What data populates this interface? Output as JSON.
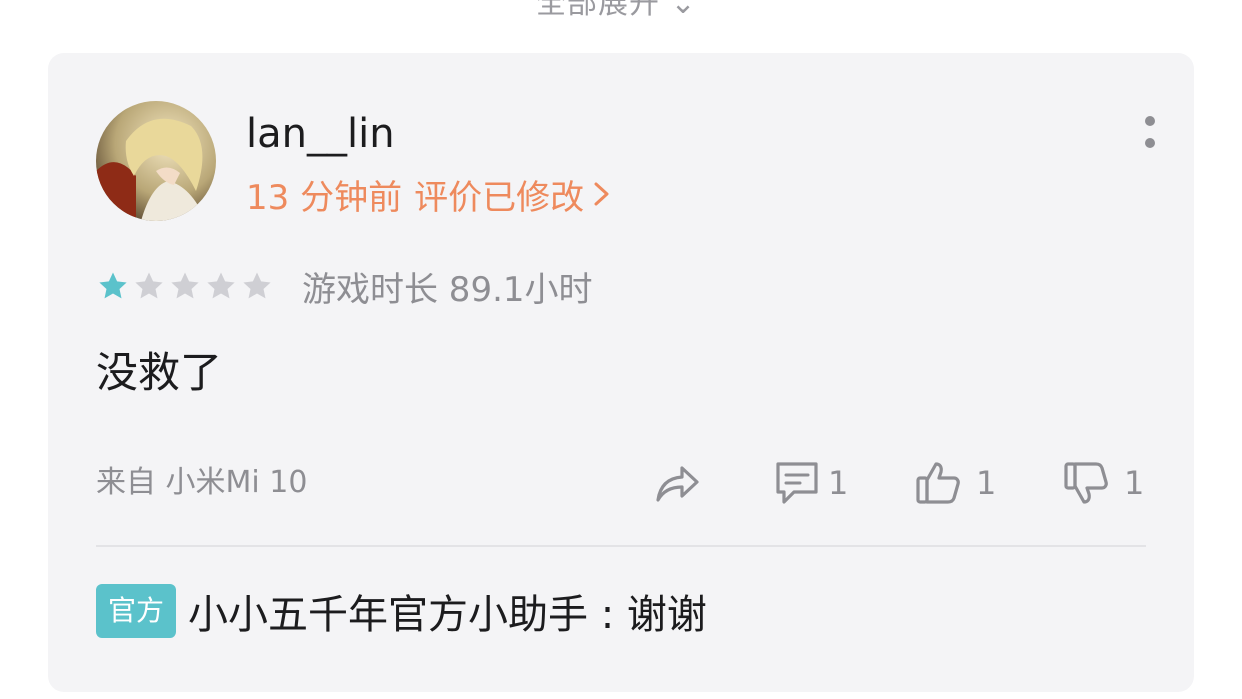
{
  "header": {
    "expand_label": "全部展开"
  },
  "review": {
    "username": "lan__lin",
    "time_ago": "13 分钟前",
    "edited_label": "评价已修改",
    "rating": 1,
    "rating_max": 5,
    "playtime_label": "游戏时长 89.1小时",
    "content": "没救了",
    "device": "来自 小米Mi 10",
    "comment_count": "1",
    "like_count": "1",
    "dislike_count": "1"
  },
  "reply": {
    "badge": "官方",
    "text": "小小五千年官方小助手 : 谢谢"
  },
  "colors": {
    "accent_orange": "#ee8a5d",
    "star_active": "#5bc2cb",
    "star_inactive": "#cfcfd4",
    "badge": "#5bc2cb",
    "card_bg": "#f4f4f6"
  },
  "icons": {
    "share": "share-arrow-icon",
    "comment": "comment-icon",
    "like": "thumbs-up-icon",
    "dislike": "thumbs-down-icon",
    "more": "more-vertical-icon",
    "chevron": "chevron-right-icon"
  }
}
